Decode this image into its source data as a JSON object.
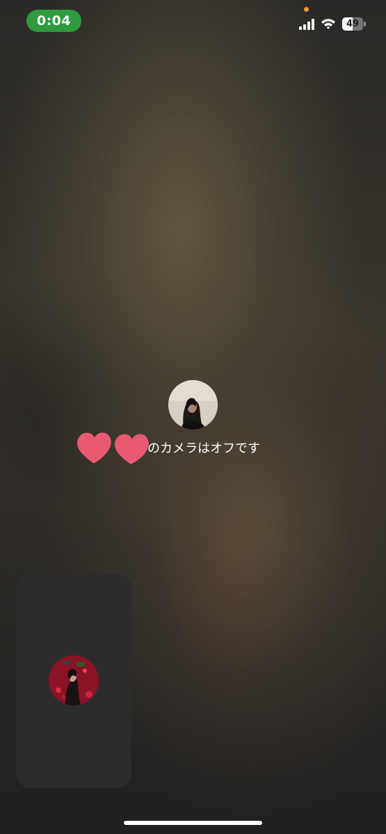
{
  "status_bar": {
    "time": "0:04",
    "battery_level": "49",
    "battery_fraction": 0.49,
    "signal_bars": 4,
    "time_pill_color": "#2f9a3e",
    "mic_indicator_color": "#f29a2e"
  },
  "call": {
    "camera_off_message": "のカメラはオフです",
    "name_emoji_icons": [
      "heart-icon",
      "heart-icon"
    ],
    "heart_color": "#e95a70"
  },
  "icons": {
    "signal": "cellular-signal-icon",
    "wifi": "wifi-icon",
    "battery": "battery-icon"
  }
}
